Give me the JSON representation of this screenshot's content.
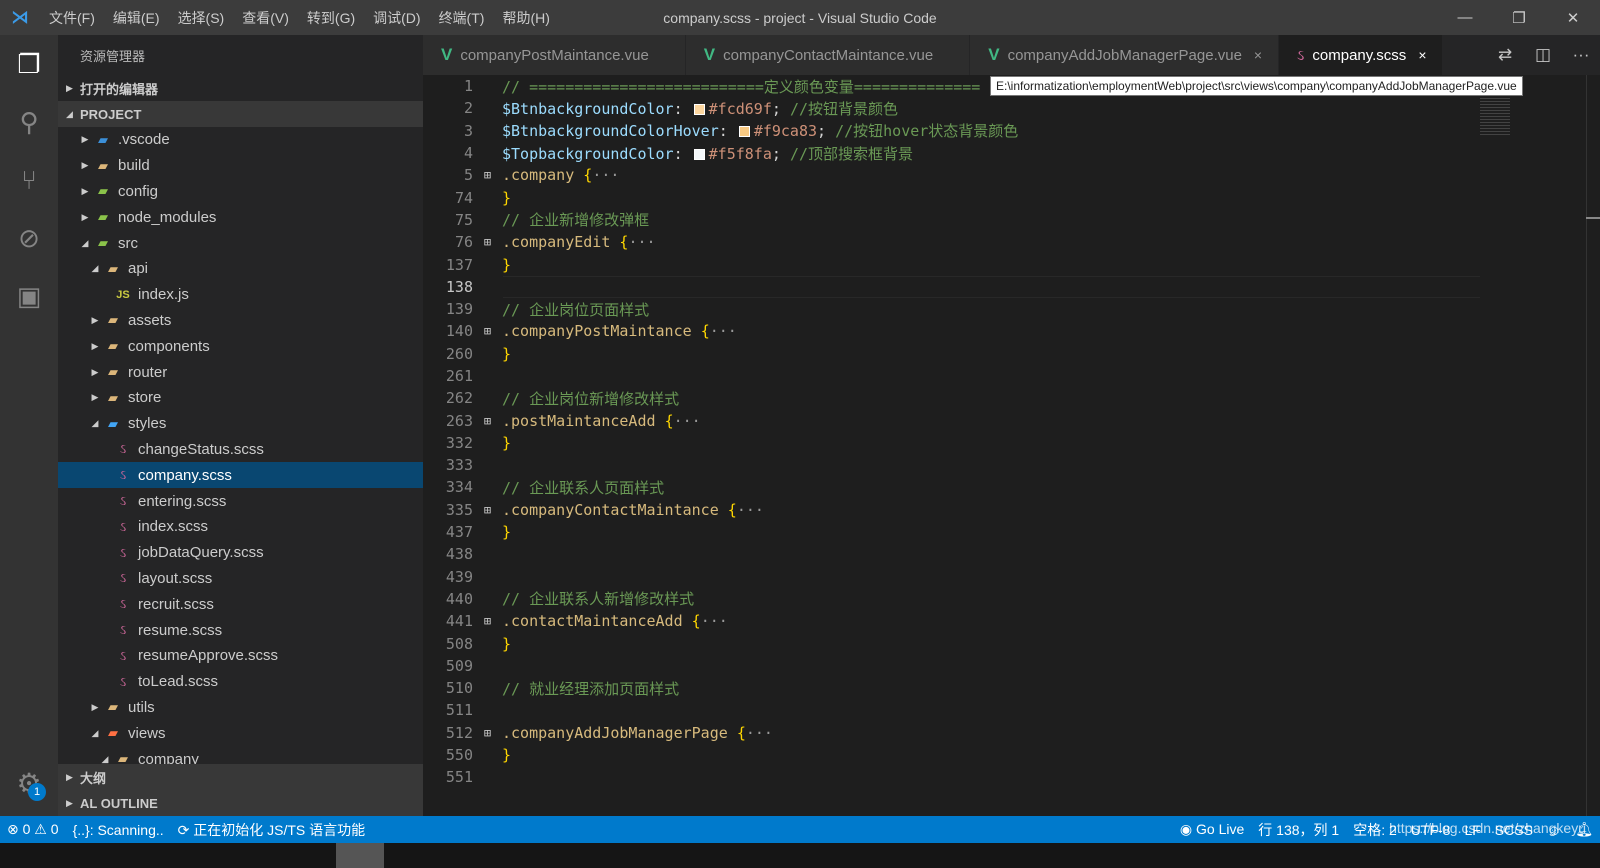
{
  "titlebar": {
    "menus": [
      "文件(F)",
      "编辑(E)",
      "选择(S)",
      "查看(V)",
      "转到(G)",
      "调试(D)",
      "终端(T)",
      "帮助(H)"
    ],
    "title": "company.scss - project - Visual Studio Code"
  },
  "activity": {
    "badge": "1"
  },
  "sidebar": {
    "header": "资源管理器",
    "open_editors": "打开的编辑器",
    "project": "PROJECT",
    "outline": "大纲",
    "al_outline": "AL OUTLINE",
    "items": [
      {
        "label": ".vscode",
        "depth": 1,
        "arrow": "▶",
        "icon": "folder-vscode"
      },
      {
        "label": "build",
        "depth": 1,
        "arrow": "▶",
        "icon": "folder"
      },
      {
        "label": "config",
        "depth": 1,
        "arrow": "▶",
        "icon": "folder-config"
      },
      {
        "label": "node_modules",
        "depth": 1,
        "arrow": "▶",
        "icon": "folder-node"
      },
      {
        "label": "src",
        "depth": 1,
        "arrow": "◢",
        "icon": "folder-src"
      },
      {
        "label": "api",
        "depth": 2,
        "arrow": "◢",
        "icon": "folder-api"
      },
      {
        "label": "index.js",
        "depth": 3,
        "arrow": "",
        "icon": "js"
      },
      {
        "label": "assets",
        "depth": 2,
        "arrow": "▶",
        "icon": "folder"
      },
      {
        "label": "components",
        "depth": 2,
        "arrow": "▶",
        "icon": "folder"
      },
      {
        "label": "router",
        "depth": 2,
        "arrow": "▶",
        "icon": "folder"
      },
      {
        "label": "store",
        "depth": 2,
        "arrow": "▶",
        "icon": "folder"
      },
      {
        "label": "styles",
        "depth": 2,
        "arrow": "◢",
        "icon": "folder-styles"
      },
      {
        "label": "changeStatus.scss",
        "depth": 3,
        "arrow": "",
        "icon": "scss"
      },
      {
        "label": "company.scss",
        "depth": 3,
        "arrow": "",
        "icon": "scss",
        "selected": true
      },
      {
        "label": "entering.scss",
        "depth": 3,
        "arrow": "",
        "icon": "scss"
      },
      {
        "label": "index.scss",
        "depth": 3,
        "arrow": "",
        "icon": "scss"
      },
      {
        "label": "jobDataQuery.scss",
        "depth": 3,
        "arrow": "",
        "icon": "scss"
      },
      {
        "label": "layout.scss",
        "depth": 3,
        "arrow": "",
        "icon": "scss"
      },
      {
        "label": "recruit.scss",
        "depth": 3,
        "arrow": "",
        "icon": "scss"
      },
      {
        "label": "resume.scss",
        "depth": 3,
        "arrow": "",
        "icon": "scss"
      },
      {
        "label": "resumeApprove.scss",
        "depth": 3,
        "arrow": "",
        "icon": "scss"
      },
      {
        "label": "toLead.scss",
        "depth": 3,
        "arrow": "",
        "icon": "scss"
      },
      {
        "label": "utils",
        "depth": 2,
        "arrow": "▶",
        "icon": "folder-utils"
      },
      {
        "label": "views",
        "depth": 2,
        "arrow": "◢",
        "icon": "folder-views"
      },
      {
        "label": "company",
        "depth": 3,
        "arrow": "◢",
        "icon": "folder"
      }
    ]
  },
  "tabs": [
    {
      "label": "companyPostMaintance.vue",
      "type": "vue"
    },
    {
      "label": "companyContactMaintance.vue",
      "type": "vue"
    },
    {
      "label": "companyAddJobManagerPage.vue",
      "type": "vue",
      "close": "×"
    },
    {
      "label": "company.scss",
      "type": "scss",
      "active": true,
      "close": "×"
    }
  ],
  "tooltip": "E:\\informatization\\employmentWeb\\project\\src\\views\\company\\companyAddJobManagerPage.vue",
  "code": [
    {
      "n": "1",
      "tokens": [
        [
          "c-com",
          "// ==========================定义颜色变量=============="
        ]
      ]
    },
    {
      "n": "2",
      "tokens": [
        [
          "c-var",
          "$BtnbackgroundColor"
        ],
        [
          "c-pun",
          ": "
        ],
        [
          "sw",
          "#fcd69f"
        ],
        [
          "c-val",
          "#fcd69f"
        ],
        [
          "c-pun",
          "; "
        ],
        [
          "c-com",
          "//按钮背景颜色"
        ]
      ]
    },
    {
      "n": "3",
      "tokens": [
        [
          "c-var",
          "$BtnbackgroundColorHover"
        ],
        [
          "c-pun",
          ": "
        ],
        [
          "sw",
          "#f9ca83"
        ],
        [
          "c-val",
          "#f9ca83"
        ],
        [
          "c-pun",
          "; "
        ],
        [
          "c-com",
          "//按钮hover状态背景颜色"
        ]
      ]
    },
    {
      "n": "4",
      "tokens": [
        [
          "c-var",
          "$TopbackgroundColor"
        ],
        [
          "c-pun",
          ": "
        ],
        [
          "sw",
          "#f5f8fa"
        ],
        [
          "c-val",
          "#f5f8fa"
        ],
        [
          "c-pun",
          "; "
        ],
        [
          "c-com",
          "//顶部搜索框背景"
        ]
      ]
    },
    {
      "n": "5",
      "fold": true,
      "tokens": [
        [
          "c-sel",
          ".company "
        ],
        [
          "c-br",
          "{"
        ],
        [
          "c-dots",
          "···"
        ]
      ]
    },
    {
      "n": "74",
      "tokens": [
        [
          "c-br",
          "}"
        ]
      ]
    },
    {
      "n": "75",
      "tokens": [
        [
          "c-com",
          "// 企业新增修改弹框"
        ]
      ]
    },
    {
      "n": "76",
      "fold": true,
      "tokens": [
        [
          "c-sel",
          ".companyEdit "
        ],
        [
          "c-br",
          "{"
        ],
        [
          "c-dots",
          "···"
        ]
      ]
    },
    {
      "n": "137",
      "tokens": [
        [
          "c-br",
          "}"
        ]
      ]
    },
    {
      "n": "138",
      "current": true,
      "tokens": []
    },
    {
      "n": "139",
      "tokens": [
        [
          "c-com",
          "// 企业岗位页面样式"
        ]
      ]
    },
    {
      "n": "140",
      "fold": true,
      "tokens": [
        [
          "c-sel",
          ".companyPostMaintance "
        ],
        [
          "c-br",
          "{"
        ],
        [
          "c-dots",
          "···"
        ]
      ]
    },
    {
      "n": "260",
      "tokens": [
        [
          "c-br",
          "}"
        ]
      ]
    },
    {
      "n": "261",
      "tokens": []
    },
    {
      "n": "262",
      "tokens": [
        [
          "c-com",
          "// 企业岗位新增修改样式"
        ]
      ]
    },
    {
      "n": "263",
      "fold": true,
      "tokens": [
        [
          "c-sel",
          ".postMaintanceAdd "
        ],
        [
          "c-br",
          "{"
        ],
        [
          "c-dots",
          "···"
        ]
      ]
    },
    {
      "n": "332",
      "tokens": [
        [
          "c-br",
          "}"
        ]
      ]
    },
    {
      "n": "333",
      "tokens": []
    },
    {
      "n": "334",
      "tokens": [
        [
          "c-com",
          "// 企业联系人页面样式"
        ]
      ]
    },
    {
      "n": "335",
      "fold": true,
      "tokens": [
        [
          "c-sel",
          ".companyContactMaintance "
        ],
        [
          "c-br",
          "{"
        ],
        [
          "c-dots",
          "···"
        ]
      ]
    },
    {
      "n": "437",
      "tokens": [
        [
          "c-br",
          "}"
        ]
      ]
    },
    {
      "n": "438",
      "tokens": []
    },
    {
      "n": "439",
      "tokens": []
    },
    {
      "n": "440",
      "tokens": [
        [
          "c-com",
          "// 企业联系人新增修改样式"
        ]
      ]
    },
    {
      "n": "441",
      "fold": true,
      "tokens": [
        [
          "c-sel",
          ".contactMaintanceAdd "
        ],
        [
          "c-br",
          "{"
        ],
        [
          "c-dots",
          "···"
        ]
      ]
    },
    {
      "n": "508",
      "tokens": [
        [
          "c-br",
          "}"
        ]
      ]
    },
    {
      "n": "509",
      "tokens": []
    },
    {
      "n": "510",
      "tokens": [
        [
          "c-com",
          "// 就业经理添加页面样式"
        ]
      ]
    },
    {
      "n": "511",
      "tokens": []
    },
    {
      "n": "512",
      "fold": true,
      "tokens": [
        [
          "c-sel",
          ".companyAddJobManagerPage "
        ],
        [
          "c-br",
          "{"
        ],
        [
          "c-dots",
          "···"
        ]
      ]
    },
    {
      "n": "550",
      "tokens": [
        [
          "c-br",
          "}"
        ]
      ]
    },
    {
      "n": "551",
      "tokens": []
    }
  ],
  "status": {
    "errors": "0",
    "warnings": "0",
    "scanning": "{..}: Scanning..",
    "init": "正在初始化 JS/TS 语言功能",
    "golive": "Go Live",
    "position": "行 138，列 1",
    "spaces": "空格: 2",
    "encoding": "UTF-8",
    "eol": "LF",
    "language": "SCSS",
    "watermark": "https://blog.csdn.net/zhangkeyu"
  }
}
